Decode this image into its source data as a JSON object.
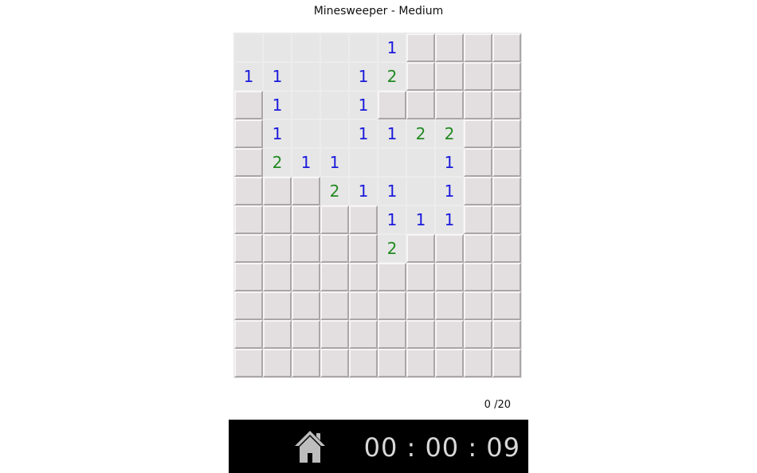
{
  "header": {
    "title": "Minesweeper - Medium"
  },
  "status": {
    "flag_counter": "0 /20"
  },
  "footer": {
    "timer": "00 : 00 : 09",
    "home_icon": "home-icon"
  },
  "colors": {
    "one": "#1a1adc",
    "two": "#218a21"
  },
  "board": {
    "rows": [
      [
        "O",
        "O",
        "O",
        "O",
        "O",
        "1",
        "C",
        "C",
        "C",
        "C"
      ],
      [
        "1",
        "1",
        "O",
        "O",
        "1",
        "2",
        "C",
        "C",
        "C",
        "C"
      ],
      [
        "C",
        "1",
        "O",
        "O",
        "1",
        "C",
        "C",
        "C",
        "C",
        "C"
      ],
      [
        "C",
        "1",
        "O",
        "O",
        "1",
        "1",
        "2",
        "2",
        "C",
        "C"
      ],
      [
        "C",
        "2",
        "1",
        "1",
        "O",
        "O",
        "O",
        "1",
        "C",
        "C"
      ],
      [
        "C",
        "C",
        "C",
        "2",
        "1",
        "1",
        "O",
        "1",
        "C",
        "C"
      ],
      [
        "C",
        "C",
        "C",
        "C",
        "C",
        "1",
        "1",
        "1",
        "C",
        "C"
      ],
      [
        "C",
        "C",
        "C",
        "C",
        "C",
        "2",
        "C",
        "C",
        "C",
        "C"
      ],
      [
        "C",
        "C",
        "C",
        "C",
        "C",
        "C",
        "C",
        "C",
        "C",
        "C"
      ],
      [
        "C",
        "C",
        "C",
        "C",
        "C",
        "C",
        "C",
        "C",
        "C",
        "C"
      ],
      [
        "C",
        "C",
        "C",
        "C",
        "C",
        "C",
        "C",
        "C",
        "C",
        "C"
      ],
      [
        "C",
        "C",
        "C",
        "C",
        "C",
        "C",
        "C",
        "C",
        "C",
        "C"
      ]
    ]
  }
}
